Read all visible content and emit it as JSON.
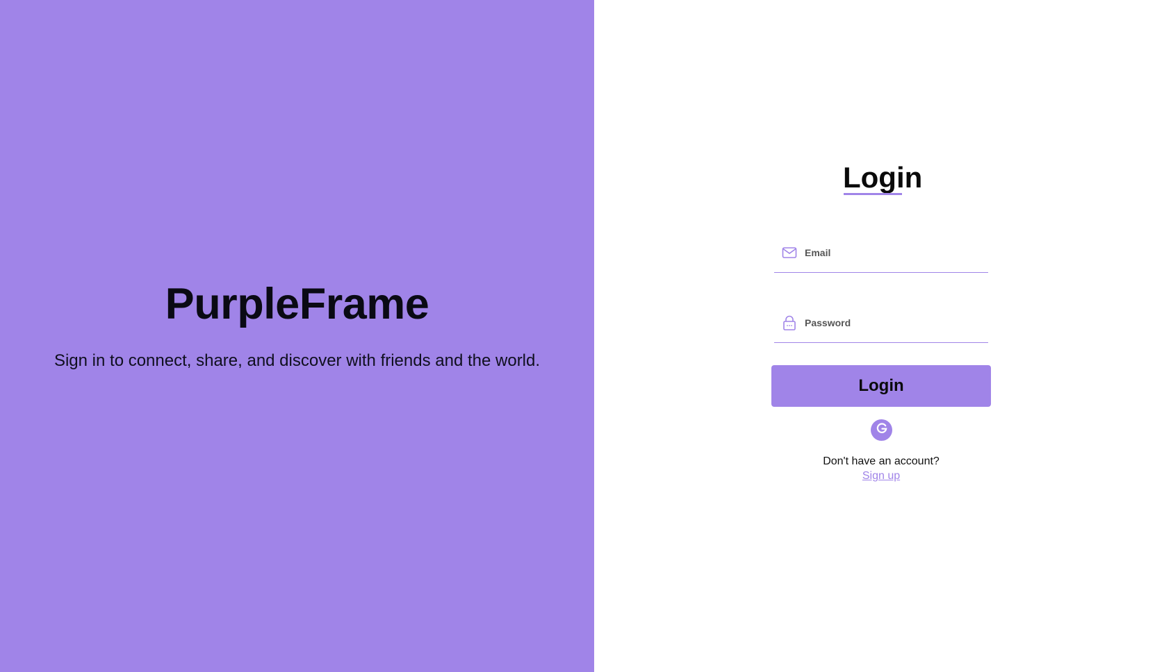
{
  "brand": {
    "name": "PurpleFrame",
    "tagline": "Sign in to connect, share, and discover with friends and the world."
  },
  "login": {
    "title": "Login",
    "email": {
      "placeholder": "Email",
      "value": "",
      "icon": "mail-icon"
    },
    "password": {
      "placeholder": "Password",
      "value": "",
      "icon": "lock-icon"
    },
    "button_label": "Login",
    "google_icon": "google-icon",
    "signup_prompt": "Don't have an account?",
    "signup_link": "Sign up"
  },
  "colors": {
    "accent": "#a084e8",
    "text": "#0a0a0a",
    "background": "#ffffff"
  }
}
